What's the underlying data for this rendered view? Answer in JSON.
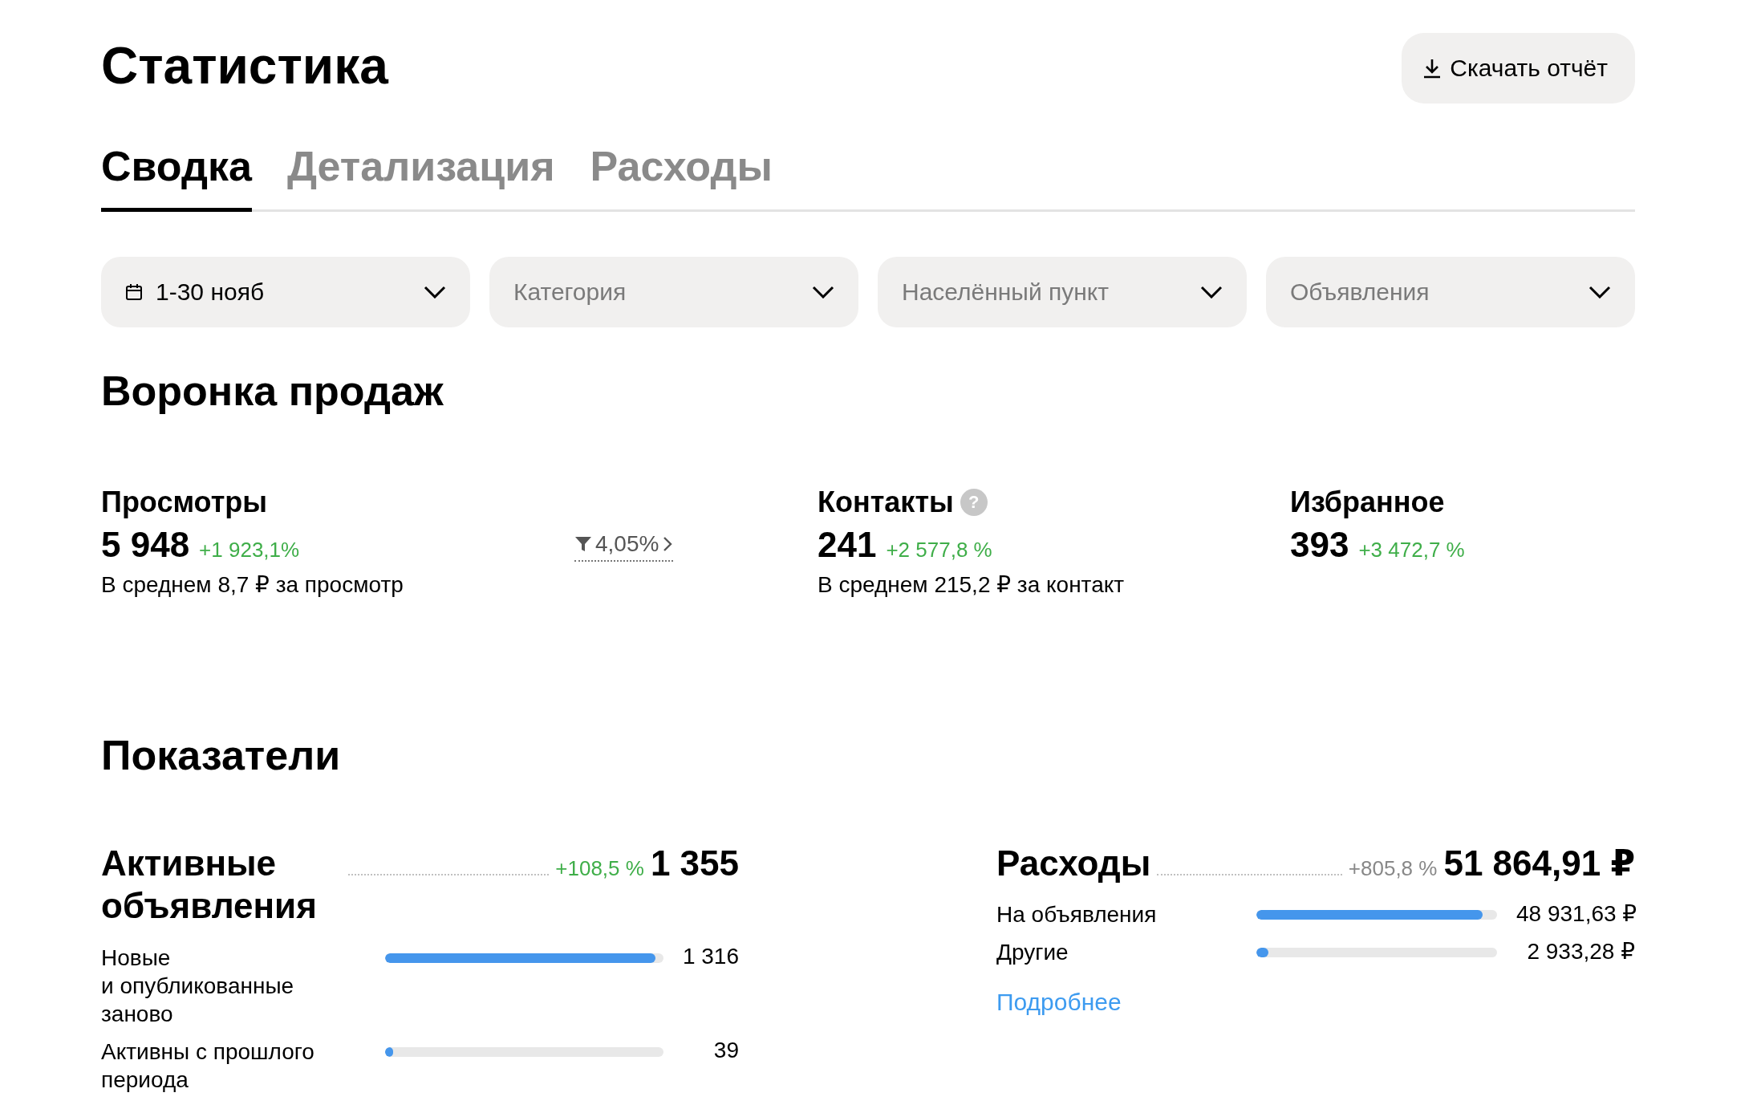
{
  "page": {
    "title": "Статистика",
    "download_button": "Скачать отчёт"
  },
  "tabs": [
    {
      "label": "Сводка",
      "selected": true
    },
    {
      "label": "Детализация",
      "selected": false
    },
    {
      "label": "Расходы",
      "selected": false
    }
  ],
  "filters": [
    {
      "kind": "date",
      "value": "1-30 нояб"
    },
    {
      "kind": "select",
      "placeholder": "Категория"
    },
    {
      "kind": "select",
      "placeholder": "Населённый пункт"
    },
    {
      "kind": "select",
      "placeholder": "Объявления"
    }
  ],
  "funnel": {
    "title": "Воронка продаж",
    "metrics": [
      {
        "label": "Просмотры",
        "value": "5 948",
        "change": "+1 923,1%",
        "note": "В среднем 8,7 ₽ за просмотр"
      },
      {
        "kind": "conversion",
        "value": "4,05%"
      },
      {
        "label": "Контакты",
        "value": "241",
        "change": "+2 577,8 %",
        "note": "В среднем 215,2 ₽ за контакт",
        "help_icon": "?"
      },
      {
        "label": "Избранное",
        "value": "393",
        "change": "+3 472,7 %"
      }
    ]
  },
  "indicators": {
    "title": "Показатели",
    "blocks": [
      {
        "title": "Активные объявления",
        "change": "+108,5 %",
        "positive": true,
        "value": "1 355",
        "rows": [
          {
            "label": "Новые\nи опубликованные\nзаново",
            "value": "1 316",
            "level": 0.97
          },
          {
            "label": "Активны с прошлого\nпериода",
            "value": "39",
            "level": 0.03
          }
        ]
      },
      {
        "title": "Расходы",
        "change": "+805,8 %",
        "positive": false,
        "value": "51 864,91 ₽",
        "rows": [
          {
            "label": "На объявления",
            "value": "48 931,63 ₽",
            "level": 0.94
          },
          {
            "label": "Другие",
            "value": "2 933,28 ₽",
            "level": 0.05
          }
        ],
        "link": "Подробнее"
      }
    ]
  }
}
